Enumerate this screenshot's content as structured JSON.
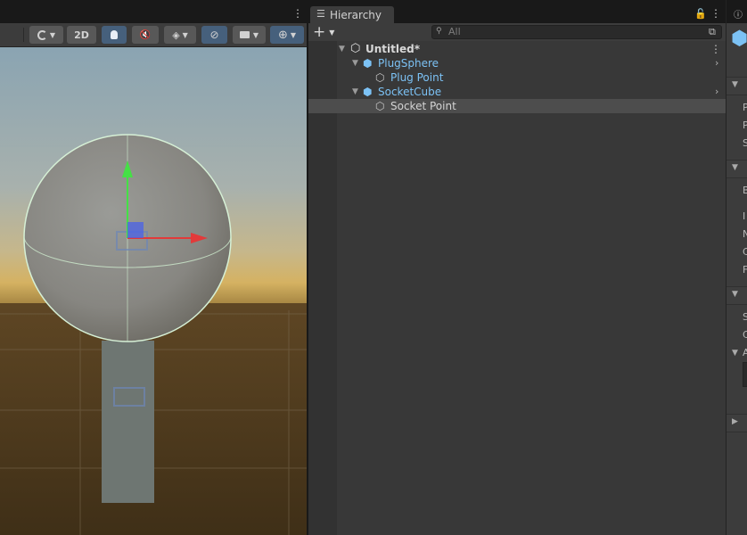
{
  "scene": {
    "mode_2d_label": "2D"
  },
  "hierarchy": {
    "tab_title": "Hierarchy",
    "add_label": "+",
    "search_placeholder": "All",
    "rows": [
      {
        "label": "Untitled*",
        "kind": "scene"
      },
      {
        "label": "PlugSphere",
        "kind": "prefab"
      },
      {
        "label": "Plug Point",
        "kind": "object"
      },
      {
        "label": "SocketCube",
        "kind": "prefab"
      },
      {
        "label": "Socket Point",
        "kind": "object",
        "selected": true
      }
    ]
  },
  "inspector": {
    "row_letters": [
      "P",
      "P",
      "S",
      "B",
      "I",
      "N",
      "C",
      "F",
      "S",
      "C",
      "A"
    ]
  },
  "colors": {
    "prefab_blue": "#7cc2f5",
    "selection_row": "#4d4d4d",
    "x_axis": "#e23a3a",
    "y_axis": "#45e045",
    "z_axis": "#4a62e8"
  }
}
